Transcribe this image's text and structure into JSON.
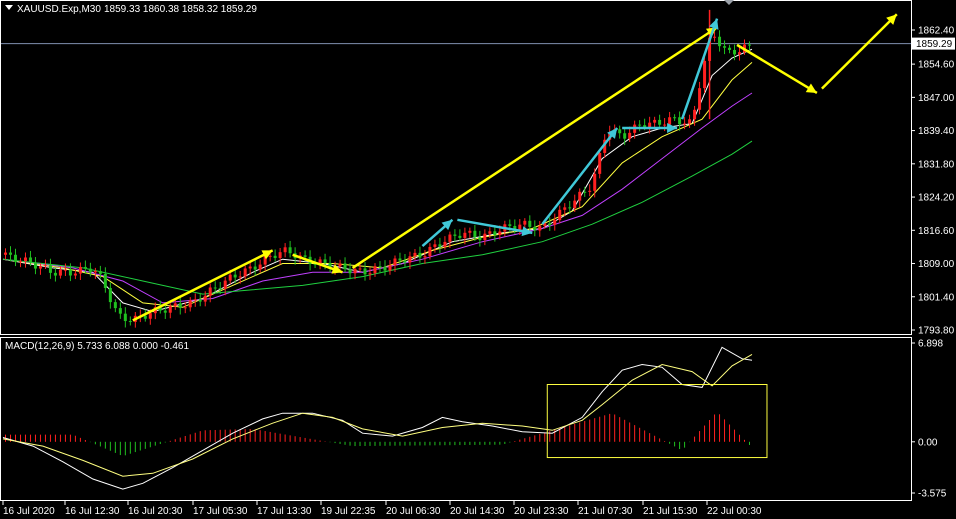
{
  "header": {
    "symbol": "XAUUSD.Exp,M30",
    "ohlc": "1859.33 1860.38 1858.32 1859.29"
  },
  "macd_header": "MACD(12,26,9) 5.733 6.088 0.000 -0.461",
  "colors": {
    "background": "#000000",
    "frame": "#ffffff",
    "bull": "#ff2020",
    "bear": "#20c020",
    "ma_fast": "#ffffff",
    "ma_mid": "#ffff40",
    "ma_slow": "#c040ff",
    "ma_long": "#20d040",
    "arrow_yellow": "#ffff00",
    "arrow_cyan": "#40c8d8",
    "macd_line": "#ffffff",
    "signal_line": "#ffff80",
    "hist_pos": "#ff2020",
    "hist_neg": "#20c020",
    "box": "#ffff40",
    "bid_line": "#8090b0"
  },
  "chart_data": [
    {
      "type": "candlestick",
      "title": "XAUUSD.Exp,M30",
      "ylim": [
        1792,
        1866
      ],
      "y_ticks": [
        "1862.40",
        "1854.60",
        "1847.00",
        "1839.40",
        "1831.80",
        "1824.20",
        "1816.60",
        "1809.00",
        "1801.40",
        "1793.80"
      ],
      "current_price": "1859.29",
      "x_ticks": [
        "16 Jul 2020",
        "16 Jul 12:30",
        "16 Jul 20:30",
        "17 Jul 05:30",
        "17 Jul 13:30",
        "19 Jul 22:35",
        "20 Jul 06:30",
        "20 Jul 14:30",
        "20 Jul 23:30",
        "21 Jul 07:30",
        "21 Jul 15:30",
        "22 Jul 00:30"
      ],
      "x_range": [
        0,
        150
      ],
      "series": [
        {
          "kind": "price",
          "points": [
            [
              0,
              1811
            ],
            [
              6,
              1809
            ],
            [
              10,
              1807
            ],
            [
              14,
              1807
            ],
            [
              18,
              1808
            ],
            [
              20,
              1805
            ],
            [
              23,
              1797
            ],
            [
              26,
              1796
            ],
            [
              28,
              1797
            ],
            [
              30,
              1798
            ],
            [
              34,
              1799
            ],
            [
              38,
              1800
            ],
            [
              42,
              1803
            ],
            [
              46,
              1806
            ],
            [
              50,
              1808
            ],
            [
              54,
              1811
            ],
            [
              57,
              1812
            ],
            [
              60,
              1810
            ],
            [
              64,
              1809
            ],
            [
              68,
              1808
            ],
            [
              72,
              1807
            ],
            [
              76,
              1808
            ],
            [
              80,
              1810
            ],
            [
              84,
              1811
            ],
            [
              88,
              1814
            ],
            [
              92,
              1816
            ],
            [
              96,
              1815
            ],
            [
              100,
              1817
            ],
            [
              104,
              1818
            ],
            [
              108,
              1817
            ],
            [
              110,
              1819
            ],
            [
              114,
              1823
            ],
            [
              118,
              1827
            ],
            [
              121,
              1840
            ],
            [
              124,
              1838
            ],
            [
              128,
              1841
            ],
            [
              131,
              1841
            ],
            [
              134,
              1842
            ],
            [
              138,
              1841
            ],
            [
              140,
              1853
            ],
            [
              142,
              1862
            ],
            [
              145,
              1857
            ],
            [
              148,
              1858
            ],
            [
              150,
              1859
            ]
          ]
        },
        {
          "kind": "ma",
          "name": "MA fast",
          "points": [
            [
              0,
              1810
            ],
            [
              10,
              1808
            ],
            [
              18,
              1807
            ],
            [
              24,
              1800
            ],
            [
              30,
              1798
            ],
            [
              40,
              1801
            ],
            [
              50,
              1807
            ],
            [
              56,
              1810
            ],
            [
              64,
              1809
            ],
            [
              72,
              1807
            ],
            [
              80,
              1809
            ],
            [
              90,
              1814
            ],
            [
              100,
              1816
            ],
            [
              108,
              1817
            ],
            [
              114,
              1821
            ],
            [
              120,
              1833
            ],
            [
              126,
              1838
            ],
            [
              132,
              1840
            ],
            [
              138,
              1841
            ],
            [
              142,
              1852
            ],
            [
              146,
              1856
            ],
            [
              150,
              1858
            ]
          ]
        },
        {
          "kind": "ma",
          "name": "MA mid",
          "points": [
            [
              0,
              1810
            ],
            [
              12,
              1808
            ],
            [
              20,
              1806
            ],
            [
              28,
              1800
            ],
            [
              36,
              1799
            ],
            [
              46,
              1804
            ],
            [
              56,
              1809
            ],
            [
              66,
              1809
            ],
            [
              76,
              1808
            ],
            [
              86,
              1812
            ],
            [
              96,
              1815
            ],
            [
              106,
              1817
            ],
            [
              116,
              1822
            ],
            [
              124,
              1832
            ],
            [
              132,
              1838
            ],
            [
              140,
              1842
            ],
            [
              146,
              1851
            ],
            [
              150,
              1855
            ]
          ]
        },
        {
          "kind": "ma",
          "name": "MA slow",
          "points": [
            [
              0,
              1810
            ],
            [
              14,
              1808
            ],
            [
              24,
              1805
            ],
            [
              32,
              1800
            ],
            [
              42,
              1801
            ],
            [
              52,
              1805
            ],
            [
              62,
              1807
            ],
            [
              72,
              1807
            ],
            [
              84,
              1810
            ],
            [
              96,
              1814
            ],
            [
              108,
              1817
            ],
            [
              116,
              1820
            ],
            [
              124,
              1826
            ],
            [
              132,
              1833
            ],
            [
              140,
              1840
            ],
            [
              146,
              1845
            ],
            [
              150,
              1848
            ]
          ]
        },
        {
          "kind": "ma",
          "name": "MA long",
          "points": [
            [
              0,
              1810
            ],
            [
              16,
              1808
            ],
            [
              28,
              1805
            ],
            [
              40,
              1802
            ],
            [
              50,
              1803
            ],
            [
              60,
              1804
            ],
            [
              72,
              1806
            ],
            [
              84,
              1809
            ],
            [
              96,
              1811
            ],
            [
              108,
              1814
            ],
            [
              118,
              1818
            ],
            [
              128,
              1823
            ],
            [
              138,
              1829
            ],
            [
              146,
              1834
            ],
            [
              150,
              1837
            ]
          ]
        }
      ],
      "annotations": [
        {
          "color": "yellow",
          "points": [
            [
              26,
              1796
            ],
            [
              54,
              1812
            ]
          ]
        },
        {
          "color": "yellow",
          "points": [
            [
              58,
              1811
            ],
            [
              68,
              1807
            ]
          ]
        },
        {
          "color": "yellow",
          "points": [
            [
              70,
              1808
            ],
            [
              143,
              1863
            ]
          ]
        },
        {
          "color": "yellow",
          "points": [
            [
              147,
              1859
            ],
            [
              163,
              1848
            ]
          ]
        },
        {
          "color": "yellow",
          "points": [
            [
              164,
              1849
            ],
            [
              179,
              1866
            ]
          ]
        },
        {
          "color": "cyan",
          "points": [
            [
              84,
              1813
            ],
            [
              90,
              1819
            ]
          ]
        },
        {
          "color": "cyan",
          "points": [
            [
              91,
              1819
            ],
            [
              106,
              1816
            ]
          ]
        },
        {
          "color": "cyan",
          "points": [
            [
              108,
              1818
            ],
            [
              123,
              1840
            ]
          ]
        },
        {
          "color": "cyan",
          "points": [
            [
              124,
              1840
            ],
            [
              135,
              1840
            ]
          ]
        },
        {
          "color": "cyan",
          "points": [
            [
              136,
              1842
            ],
            [
              143,
              1865
            ]
          ]
        }
      ]
    },
    {
      "type": "macd",
      "title": "MACD(12,26,9) 5.733 6.088 0.000 -0.461",
      "ylim": [
        -3.575,
        6.898
      ],
      "y_ticks": [
        "6.898",
        "0.00",
        "-3.575"
      ],
      "x_range": [
        0,
        150
      ],
      "macd": [
        [
          0,
          0.3
        ],
        [
          6,
          -0.3
        ],
        [
          12,
          -1.4
        ],
        [
          18,
          -2.6
        ],
        [
          24,
          -3.3
        ],
        [
          28,
          -2.9
        ],
        [
          34,
          -1.8
        ],
        [
          40,
          -0.6
        ],
        [
          46,
          0.6
        ],
        [
          52,
          1.6
        ],
        [
          56,
          2.0
        ],
        [
          62,
          2.0
        ],
        [
          68,
          1.5
        ],
        [
          72,
          0.6
        ],
        [
          78,
          0.4
        ],
        [
          84,
          1.0
        ],
        [
          88,
          1.7
        ],
        [
          92,
          1.4
        ],
        [
          98,
          1.1
        ],
        [
          104,
          0.7
        ],
        [
          110,
          0.6
        ],
        [
          116,
          1.7
        ],
        [
          120,
          3.5
        ],
        [
          124,
          5.0
        ],
        [
          128,
          5.4
        ],
        [
          132,
          5.2
        ],
        [
          136,
          4.0
        ],
        [
          140,
          3.8
        ],
        [
          144,
          6.6
        ],
        [
          148,
          5.8
        ],
        [
          150,
          5.7
        ]
      ],
      "signal": [
        [
          0,
          0.2
        ],
        [
          8,
          -0.3
        ],
        [
          16,
          -1.3
        ],
        [
          24,
          -2.4
        ],
        [
          30,
          -2.2
        ],
        [
          38,
          -1.2
        ],
        [
          46,
          0.2
        ],
        [
          54,
          1.3
        ],
        [
          60,
          2.0
        ],
        [
          66,
          1.7
        ],
        [
          72,
          0.9
        ],
        [
          80,
          0.4
        ],
        [
          88,
          1.0
        ],
        [
          96,
          1.3
        ],
        [
          104,
          1.1
        ],
        [
          110,
          0.8
        ],
        [
          116,
          1.5
        ],
        [
          120,
          2.6
        ],
        [
          126,
          4.3
        ],
        [
          132,
          5.4
        ],
        [
          138,
          4.9
        ],
        [
          142,
          3.9
        ],
        [
          146,
          5.3
        ],
        [
          150,
          6.1
        ]
      ],
      "histogram_peaks": [
        [
          14,
          0.5
        ],
        [
          24,
          -1.0
        ],
        [
          40,
          0.8
        ],
        [
          50,
          0.9
        ],
        [
          70,
          -0.3
        ],
        [
          100,
          -0.2
        ],
        [
          122,
          2.0
        ],
        [
          136,
          -0.6
        ],
        [
          143,
          2.1
        ],
        [
          150,
          -0.4
        ]
      ]
    }
  ]
}
